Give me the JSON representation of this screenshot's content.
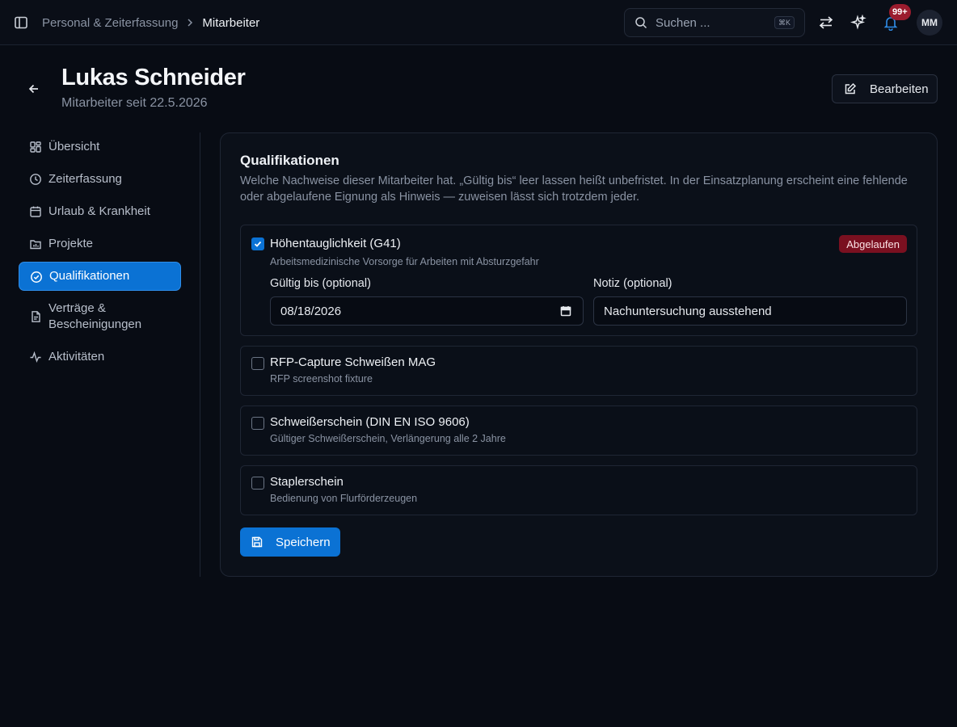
{
  "topbar": {
    "breadcrumb_parent": "Personal & Zeiterfassung",
    "breadcrumb_current": "Mitarbeiter",
    "search_placeholder": "Suchen ...",
    "search_shortcut": "⌘K",
    "notification_count": "99+",
    "avatar_initials": "MM"
  },
  "header": {
    "title": "Lukas Schneider",
    "subtitle": "Mitarbeiter seit 22.5.2026",
    "edit_label": "Bearbeiten"
  },
  "sidenav": {
    "items": [
      {
        "label": "Übersicht",
        "icon": "dashboard-icon"
      },
      {
        "label": "Zeiterfassung",
        "icon": "clock-icon"
      },
      {
        "label": "Urlaub & Krankheit",
        "icon": "calendar-icon"
      },
      {
        "label": "Projekte",
        "icon": "folder-icon"
      },
      {
        "label": "Qualifikationen",
        "icon": "check-circle-icon",
        "active": true
      },
      {
        "label": "Verträge & Bescheinigungen",
        "icon": "document-icon"
      },
      {
        "label": "Aktivitäten",
        "icon": "activity-icon"
      }
    ]
  },
  "card": {
    "title": "Qualifikationen",
    "description": "Welche Nachweise dieser Mitarbeiter hat. „Gültig bis“ leer lassen heißt unbefristet. In der Einsatzplanung erscheint eine fehlende oder abgelaufene Eignung als Hinweis — zuweisen lässt sich trotzdem jeder.",
    "qualifications": [
      {
        "name": "Höhentauglichkeit (G41)",
        "description": "Arbeitsmedizinische Vorsorge für Arbeiten mit Absturzgefahr",
        "checked": true,
        "status": "Abgelaufen",
        "valid_until_label": "Gültig bis (optional)",
        "valid_until_value": "08/18/2026",
        "note_label": "Notiz (optional)",
        "note_value": "Nachuntersuchung ausstehend"
      },
      {
        "name": "RFP-Capture Schweißen MAG",
        "description": "RFP screenshot fixture",
        "checked": false
      },
      {
        "name": "Schweißerschein (DIN EN ISO 9606)",
        "description": "Gültiger Schweißerschein, Verlängerung alle 2 Jahre",
        "checked": false
      },
      {
        "name": "Staplerschein",
        "description": "Bedienung von Flurförderzeugen",
        "checked": false
      }
    ],
    "save_label": "Speichern"
  },
  "colors": {
    "accent": "#0b72d4",
    "background": "#080c14",
    "danger_badge": "#7a1020"
  }
}
